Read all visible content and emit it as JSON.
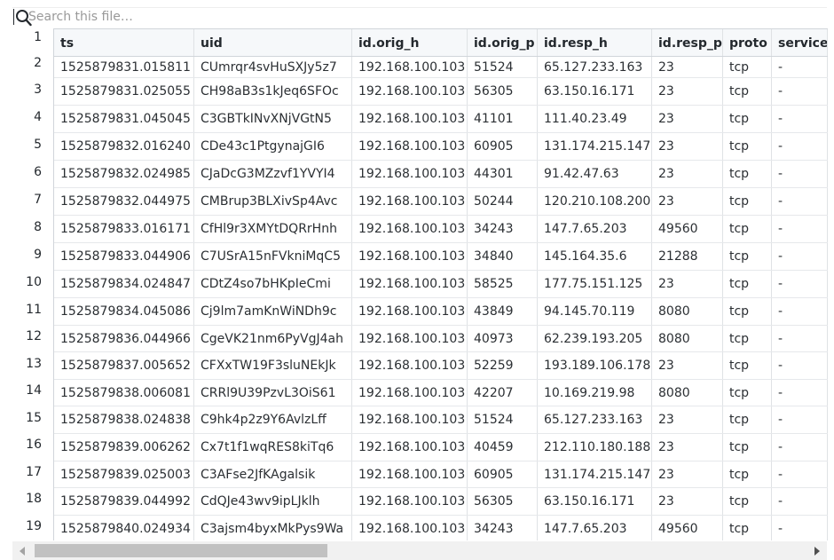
{
  "search": {
    "placeholder": "Search this file…",
    "value": ""
  },
  "line_numbers": [
    "1",
    "2",
    "3",
    "4",
    "5",
    "6",
    "7",
    "8",
    "9",
    "10",
    "11",
    "12",
    "13",
    "14",
    "15",
    "16",
    "17",
    "18",
    "19"
  ],
  "table": {
    "columns": [
      "ts",
      "uid",
      "id.orig_h",
      "id.orig_p",
      "id.resp_h",
      "id.resp_p",
      "proto",
      "service"
    ],
    "rows": [
      [
        "1525879831.015811",
        "CUmrqr4svHuSXJy5z7",
        "192.168.100.103",
        "51524",
        "65.127.233.163",
        "23",
        "tcp",
        "-"
      ],
      [
        "1525879831.025055",
        "CH98aB3s1kJeq6SFOc",
        "192.168.100.103",
        "56305",
        "63.150.16.171",
        "23",
        "tcp",
        "-"
      ],
      [
        "1525879831.045045",
        "C3GBTkINvXNjVGtN5",
        "192.168.100.103",
        "41101",
        "111.40.23.49",
        "23",
        "tcp",
        "-"
      ],
      [
        "1525879832.016240",
        "CDe43c1PtgynajGI6",
        "192.168.100.103",
        "60905",
        "131.174.215.147",
        "23",
        "tcp",
        "-"
      ],
      [
        "1525879832.024985",
        "CJaDcG3MZzvf1YVYI4",
        "192.168.100.103",
        "44301",
        "91.42.47.63",
        "23",
        "tcp",
        "-"
      ],
      [
        "1525879832.044975",
        "CMBrup3BLXivSp4Avc",
        "192.168.100.103",
        "50244",
        "120.210.108.200",
        "23",
        "tcp",
        "-"
      ],
      [
        "1525879833.016171",
        "CfHl9r3XMYtDQRrHnh",
        "192.168.100.103",
        "34243",
        "147.7.65.203",
        "49560",
        "tcp",
        "-"
      ],
      [
        "1525879833.044906",
        "C7USrA15nFVkniMqC5",
        "192.168.100.103",
        "34840",
        "145.164.35.6",
        "21288",
        "tcp",
        "-"
      ],
      [
        "1525879834.024847",
        "CDtZ4so7bHKpIeCmi",
        "192.168.100.103",
        "58525",
        "177.75.151.125",
        "23",
        "tcp",
        "-"
      ],
      [
        "1525879834.045086",
        "Cj9lm7amKnWiNDh9c",
        "192.168.100.103",
        "43849",
        "94.145.70.119",
        "8080",
        "tcp",
        "-"
      ],
      [
        "1525879836.044966",
        "CgeVK21nm6PyVgJ4ah",
        "192.168.100.103",
        "40973",
        "62.239.193.205",
        "8080",
        "tcp",
        "-"
      ],
      [
        "1525879837.005652",
        "CFXxTW19F3sluNEkJk",
        "192.168.100.103",
        "52259",
        "193.189.106.178",
        "23",
        "tcp",
        "-"
      ],
      [
        "1525879838.006081",
        "CRRl9U39PzvL3OiS61",
        "192.168.100.103",
        "42207",
        "10.169.219.98",
        "8080",
        "tcp",
        "-"
      ],
      [
        "1525879838.024838",
        "C9hk4p2z9Y6AvlzLff",
        "192.168.100.103",
        "51524",
        "65.127.233.163",
        "23",
        "tcp",
        "-"
      ],
      [
        "1525879839.006262",
        "Cx7t1f1wqRES8kiTq6",
        "192.168.100.103",
        "40459",
        "212.110.180.188",
        "23",
        "tcp",
        "-"
      ],
      [
        "1525879839.025003",
        "C3AFse2JfKAgalsik",
        "192.168.100.103",
        "60905",
        "131.174.215.147",
        "23",
        "tcp",
        "-"
      ],
      [
        "1525879839.044992",
        "CdQJe43wv9ipLJklh",
        "192.168.100.103",
        "56305",
        "63.150.16.171",
        "23",
        "tcp",
        "-"
      ],
      [
        "1525879840.024934",
        "C3ajsm4byxMkPys9Wa",
        "192.168.100.103",
        "34243",
        "147.7.65.203",
        "49560",
        "tcp",
        "-"
      ]
    ]
  },
  "icons": {
    "search": "search-icon",
    "scroll_left": "triangle-left-icon",
    "scroll_right": "triangle-right-icon"
  },
  "colors": {
    "header_bg": "#f6f8fa",
    "border": "#d1d5da",
    "scrollbar_thumb": "#c1c1c1"
  }
}
